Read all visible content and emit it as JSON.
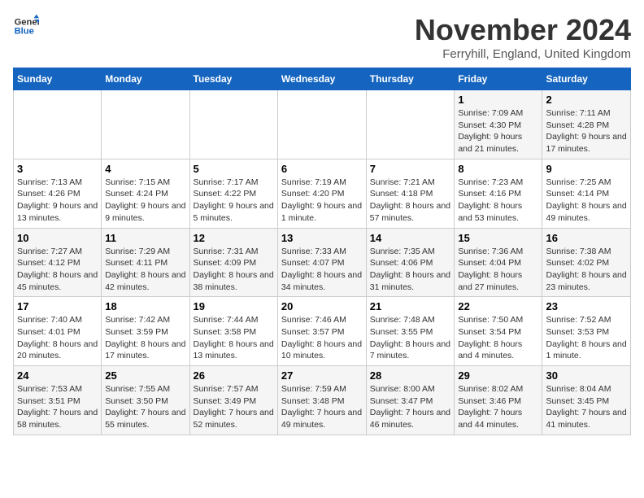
{
  "logo": {
    "line1": "General",
    "line2": "Blue"
  },
  "title": "November 2024",
  "location": "Ferryhill, England, United Kingdom",
  "days_header": [
    "Sunday",
    "Monday",
    "Tuesday",
    "Wednesday",
    "Thursday",
    "Friday",
    "Saturday"
  ],
  "weeks": [
    [
      {
        "day": "",
        "sunrise": "",
        "sunset": "",
        "daylight": ""
      },
      {
        "day": "",
        "sunrise": "",
        "sunset": "",
        "daylight": ""
      },
      {
        "day": "",
        "sunrise": "",
        "sunset": "",
        "daylight": ""
      },
      {
        "day": "",
        "sunrise": "",
        "sunset": "",
        "daylight": ""
      },
      {
        "day": "",
        "sunrise": "",
        "sunset": "",
        "daylight": ""
      },
      {
        "day": "1",
        "sunrise": "Sunrise: 7:09 AM",
        "sunset": "Sunset: 4:30 PM",
        "daylight": "Daylight: 9 hours and 21 minutes."
      },
      {
        "day": "2",
        "sunrise": "Sunrise: 7:11 AM",
        "sunset": "Sunset: 4:28 PM",
        "daylight": "Daylight: 9 hours and 17 minutes."
      }
    ],
    [
      {
        "day": "3",
        "sunrise": "Sunrise: 7:13 AM",
        "sunset": "Sunset: 4:26 PM",
        "daylight": "Daylight: 9 hours and 13 minutes."
      },
      {
        "day": "4",
        "sunrise": "Sunrise: 7:15 AM",
        "sunset": "Sunset: 4:24 PM",
        "daylight": "Daylight: 9 hours and 9 minutes."
      },
      {
        "day": "5",
        "sunrise": "Sunrise: 7:17 AM",
        "sunset": "Sunset: 4:22 PM",
        "daylight": "Daylight: 9 hours and 5 minutes."
      },
      {
        "day": "6",
        "sunrise": "Sunrise: 7:19 AM",
        "sunset": "Sunset: 4:20 PM",
        "daylight": "Daylight: 9 hours and 1 minute."
      },
      {
        "day": "7",
        "sunrise": "Sunrise: 7:21 AM",
        "sunset": "Sunset: 4:18 PM",
        "daylight": "Daylight: 8 hours and 57 minutes."
      },
      {
        "day": "8",
        "sunrise": "Sunrise: 7:23 AM",
        "sunset": "Sunset: 4:16 PM",
        "daylight": "Daylight: 8 hours and 53 minutes."
      },
      {
        "day": "9",
        "sunrise": "Sunrise: 7:25 AM",
        "sunset": "Sunset: 4:14 PM",
        "daylight": "Daylight: 8 hours and 49 minutes."
      }
    ],
    [
      {
        "day": "10",
        "sunrise": "Sunrise: 7:27 AM",
        "sunset": "Sunset: 4:12 PM",
        "daylight": "Daylight: 8 hours and 45 minutes."
      },
      {
        "day": "11",
        "sunrise": "Sunrise: 7:29 AM",
        "sunset": "Sunset: 4:11 PM",
        "daylight": "Daylight: 8 hours and 42 minutes."
      },
      {
        "day": "12",
        "sunrise": "Sunrise: 7:31 AM",
        "sunset": "Sunset: 4:09 PM",
        "daylight": "Daylight: 8 hours and 38 minutes."
      },
      {
        "day": "13",
        "sunrise": "Sunrise: 7:33 AM",
        "sunset": "Sunset: 4:07 PM",
        "daylight": "Daylight: 8 hours and 34 minutes."
      },
      {
        "day": "14",
        "sunrise": "Sunrise: 7:35 AM",
        "sunset": "Sunset: 4:06 PM",
        "daylight": "Daylight: 8 hours and 31 minutes."
      },
      {
        "day": "15",
        "sunrise": "Sunrise: 7:36 AM",
        "sunset": "Sunset: 4:04 PM",
        "daylight": "Daylight: 8 hours and 27 minutes."
      },
      {
        "day": "16",
        "sunrise": "Sunrise: 7:38 AM",
        "sunset": "Sunset: 4:02 PM",
        "daylight": "Daylight: 8 hours and 23 minutes."
      }
    ],
    [
      {
        "day": "17",
        "sunrise": "Sunrise: 7:40 AM",
        "sunset": "Sunset: 4:01 PM",
        "daylight": "Daylight: 8 hours and 20 minutes."
      },
      {
        "day": "18",
        "sunrise": "Sunrise: 7:42 AM",
        "sunset": "Sunset: 3:59 PM",
        "daylight": "Daylight: 8 hours and 17 minutes."
      },
      {
        "day": "19",
        "sunrise": "Sunrise: 7:44 AM",
        "sunset": "Sunset: 3:58 PM",
        "daylight": "Daylight: 8 hours and 13 minutes."
      },
      {
        "day": "20",
        "sunrise": "Sunrise: 7:46 AM",
        "sunset": "Sunset: 3:57 PM",
        "daylight": "Daylight: 8 hours and 10 minutes."
      },
      {
        "day": "21",
        "sunrise": "Sunrise: 7:48 AM",
        "sunset": "Sunset: 3:55 PM",
        "daylight": "Daylight: 8 hours and 7 minutes."
      },
      {
        "day": "22",
        "sunrise": "Sunrise: 7:50 AM",
        "sunset": "Sunset: 3:54 PM",
        "daylight": "Daylight: 8 hours and 4 minutes."
      },
      {
        "day": "23",
        "sunrise": "Sunrise: 7:52 AM",
        "sunset": "Sunset: 3:53 PM",
        "daylight": "Daylight: 8 hours and 1 minute."
      }
    ],
    [
      {
        "day": "24",
        "sunrise": "Sunrise: 7:53 AM",
        "sunset": "Sunset: 3:51 PM",
        "daylight": "Daylight: 7 hours and 58 minutes."
      },
      {
        "day": "25",
        "sunrise": "Sunrise: 7:55 AM",
        "sunset": "Sunset: 3:50 PM",
        "daylight": "Daylight: 7 hours and 55 minutes."
      },
      {
        "day": "26",
        "sunrise": "Sunrise: 7:57 AM",
        "sunset": "Sunset: 3:49 PM",
        "daylight": "Daylight: 7 hours and 52 minutes."
      },
      {
        "day": "27",
        "sunrise": "Sunrise: 7:59 AM",
        "sunset": "Sunset: 3:48 PM",
        "daylight": "Daylight: 7 hours and 49 minutes."
      },
      {
        "day": "28",
        "sunrise": "Sunrise: 8:00 AM",
        "sunset": "Sunset: 3:47 PM",
        "daylight": "Daylight: 7 hours and 46 minutes."
      },
      {
        "day": "29",
        "sunrise": "Sunrise: 8:02 AM",
        "sunset": "Sunset: 3:46 PM",
        "daylight": "Daylight: 7 hours and 44 minutes."
      },
      {
        "day": "30",
        "sunrise": "Sunrise: 8:04 AM",
        "sunset": "Sunset: 3:45 PM",
        "daylight": "Daylight: 7 hours and 41 minutes."
      }
    ]
  ]
}
